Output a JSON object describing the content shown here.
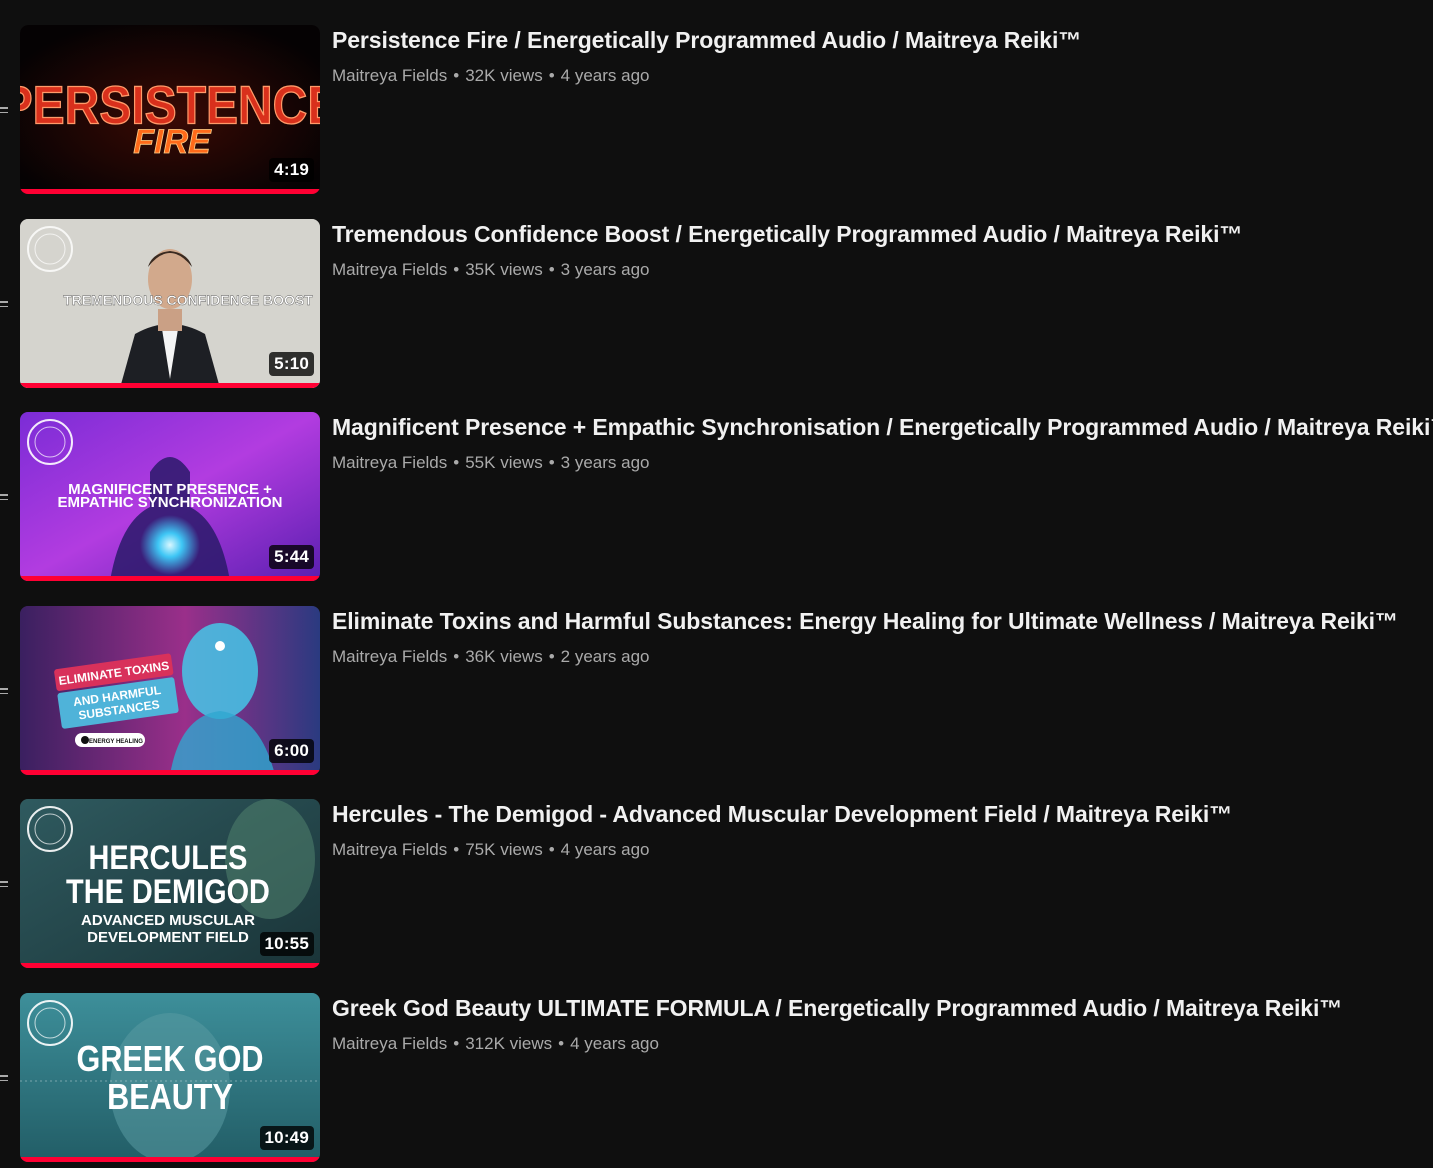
{
  "videos": [
    {
      "title": "Persistence Fire / Energetically Programmed Audio / Maitreya Reiki™",
      "channel": "Maitreya Fields",
      "views": "32K views",
      "age": "4 years ago",
      "duration": "4:19",
      "progress": 1.0,
      "thumb_text": [
        "PERSISTENCE",
        "FIRE"
      ]
    },
    {
      "title": "Tremendous Confidence Boost / Energetically Programmed Audio / Maitreya Reiki™",
      "channel": "Maitreya Fields",
      "views": "35K views",
      "age": "3 years ago",
      "duration": "5:10",
      "progress": 1.0,
      "thumb_text": [
        "TREMENDOUS CONFIDENCE BOOST"
      ]
    },
    {
      "title": "Magnificent Presence + Empathic Synchronisation / Energetically Programmed Audio / Maitreya Reiki™",
      "channel": "Maitreya Fields",
      "views": "55K views",
      "age": "3 years ago",
      "duration": "5:44",
      "progress": 1.0,
      "thumb_text": [
        "MAGNIFICENT PRESENCE +",
        "EMPATHIC SYNCHRONIZATION"
      ]
    },
    {
      "title": "Eliminate Toxins and Harmful Substances: Energy Healing for Ultimate Wellness / Maitreya Reiki™",
      "channel": "Maitreya Fields",
      "views": "36K views",
      "age": "2 years ago",
      "duration": "6:00",
      "progress": 1.0,
      "thumb_text": [
        "ELIMINATE TOXINS",
        "AND HARMFUL",
        "SUBSTANCES",
        "ENERGY HEALING"
      ]
    },
    {
      "title": "Hercules - The Demigod - Advanced Muscular Development Field / Maitreya Reiki™",
      "channel": "Maitreya Fields",
      "views": "75K views",
      "age": "4 years ago",
      "duration": "10:55",
      "progress": 1.0,
      "thumb_text": [
        "HERCULES",
        "THE DEMIGOD",
        "ADVANCED MUSCULAR",
        "DEVELOPMENT FIELD"
      ]
    },
    {
      "title": "Greek God Beauty ULTIMATE FORMULA / Energetically Programmed Audio / Maitreya Reiki™",
      "channel": "Maitreya Fields",
      "views": "312K views",
      "age": "4 years ago",
      "duration": "10:49",
      "progress": 1.0,
      "thumb_text": [
        "GREEK GOD",
        "BEAUTY"
      ]
    }
  ],
  "dot": "•",
  "colors": {
    "progress": "#ff0033",
    "background": "#0f0f0f",
    "meta": "#aaaaaa"
  }
}
